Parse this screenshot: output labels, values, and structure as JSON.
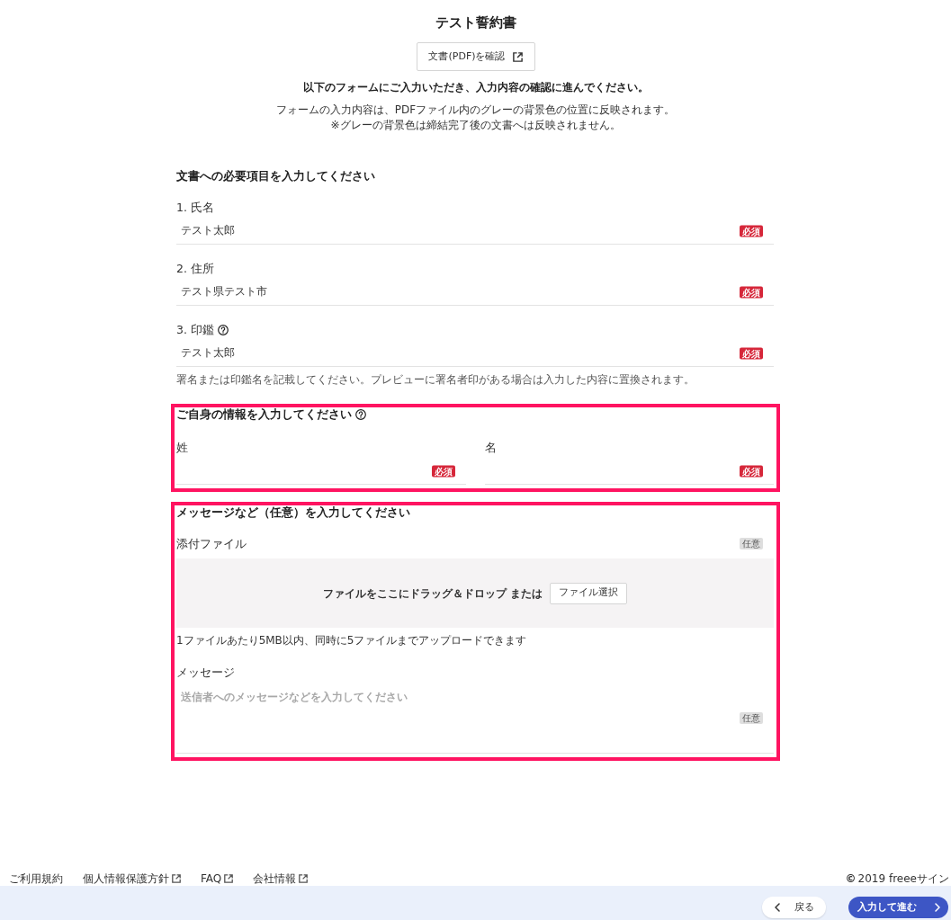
{
  "title": "テスト誓約書",
  "pdf_button": {
    "label": "文書(PDF)を確認",
    "external": true
  },
  "instruction": "以下のフォームにご入力いただき、入力内容の確認に進んでください。",
  "notes": [
    "フォームの入力内容は、PDFファイル内のグレーの背景色の位置に反映されます。",
    "※グレーの背景色は締結完了後の文書へは反映されません。"
  ],
  "sections": [
    {
      "heading": "文書への必要項目を入力してください",
      "help": false,
      "highlighted": false,
      "fields": [
        {
          "kind": "text",
          "label": "1. 氏名",
          "help": false,
          "value": "テスト太郎",
          "badge": {
            "kind": "required",
            "text": "必須"
          }
        },
        {
          "kind": "text",
          "label": "2. 住所",
          "help": false,
          "value": "テスト県テスト市",
          "badge": {
            "kind": "required",
            "text": "必須"
          }
        },
        {
          "kind": "text",
          "label": "3. 印鑑",
          "help": true,
          "value": "テスト太郎",
          "badge": {
            "kind": "required",
            "text": "必須"
          },
          "hint": "署名または印鑑名を記載してください。プレビューに署名者印がある場合は入力した内容に置換されます。"
        }
      ]
    },
    {
      "heading": "ご自身の情報を入力してください",
      "help": true,
      "highlighted": true,
      "fields": [
        {
          "kind": "half",
          "label": "姓",
          "help": false,
          "badge": {
            "kind": "required",
            "text": "必須"
          }
        },
        {
          "kind": "half",
          "label": "名",
          "help": false,
          "badge": {
            "kind": "required",
            "text": "必須"
          }
        }
      ]
    },
    {
      "heading": "メッセージなど（任意）を入力してください",
      "help": false,
      "highlighted": true,
      "fields": [
        {
          "kind": "file",
          "label": "添付ファイル",
          "badge": {
            "kind": "optional",
            "text": "任意"
          },
          "drop_text": "ファイルをここにドラッグ＆ドロップ または",
          "button": "ファイル選択",
          "hint": "1ファイルあたり5MB以内、同時に5ファイルまでアップロードできます"
        },
        {
          "kind": "textarea",
          "label": "メッセージ",
          "placeholder": "送信者へのメッセージなどを入力してください",
          "badge": {
            "kind": "optional",
            "text": "任意"
          }
        }
      ]
    }
  ],
  "footer": {
    "links": [
      {
        "label": "ご利用規約",
        "external": false
      },
      {
        "label": "個人情報保護方針",
        "external": true
      },
      {
        "label": "FAQ",
        "external": true
      },
      {
        "label": "会社情報",
        "external": true
      }
    ],
    "copyright_mark": "©",
    "copyright": "2019 freeeサイン"
  },
  "actions": [
    {
      "kind": "back",
      "label": "戻る"
    },
    {
      "kind": "next",
      "label": "入力して進む"
    }
  ]
}
